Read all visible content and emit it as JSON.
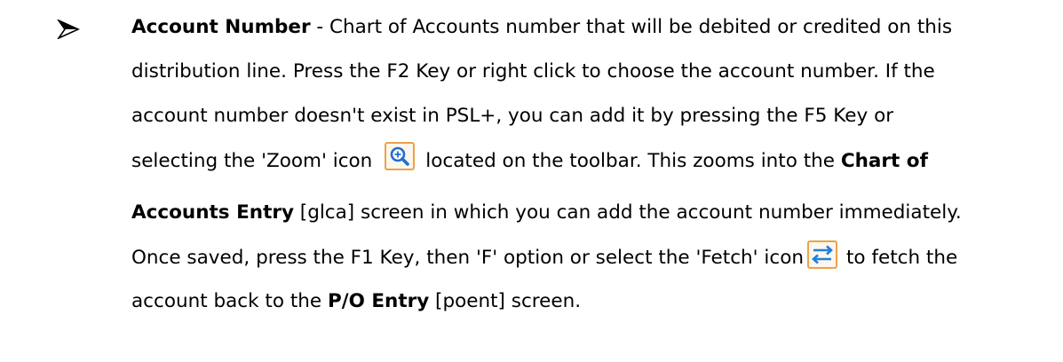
{
  "para": {
    "l1_bold": "Account Number",
    "l1_rest": " - Chart of Accounts number that will be debited or credited on this",
    "l2": "distribution line.  Press the F2 Key or right click to choose the account number.  If the",
    "l3": "account number doesn't exist in PSL+, you can add it by pressing the F5 Key or",
    "l4_before": "selecting the 'Zoom' icon",
    "l4_after": "located on the toolbar.  This zooms into the ",
    "l4_bold": "Chart of",
    "l5_bold": "Accounts Entry",
    "l5_rest": " [glca] screen in which you can add the account number immediately.",
    "l6_before": "Once saved, press the F1 Key, then 'F' option or select the 'Fetch' icon",
    "l6_after": "to fetch the",
    "l7_before": "account back to the ",
    "l7_bold": "P/O Entry",
    "l7_rest": " [poent] screen."
  },
  "icons": {
    "bullet": "arrow-bullet-icon",
    "zoom": "zoom-icon",
    "fetch": "fetch-icon"
  },
  "colors": {
    "zoom_border": "#e8a44a",
    "zoom_fill": "#fdf6ec",
    "zoom_glass": "#1f6fd0",
    "fetch_border": "#e8a44a",
    "fetch_fill": "#fdf6ec",
    "fetch_arrows": "#1f7fe0"
  }
}
